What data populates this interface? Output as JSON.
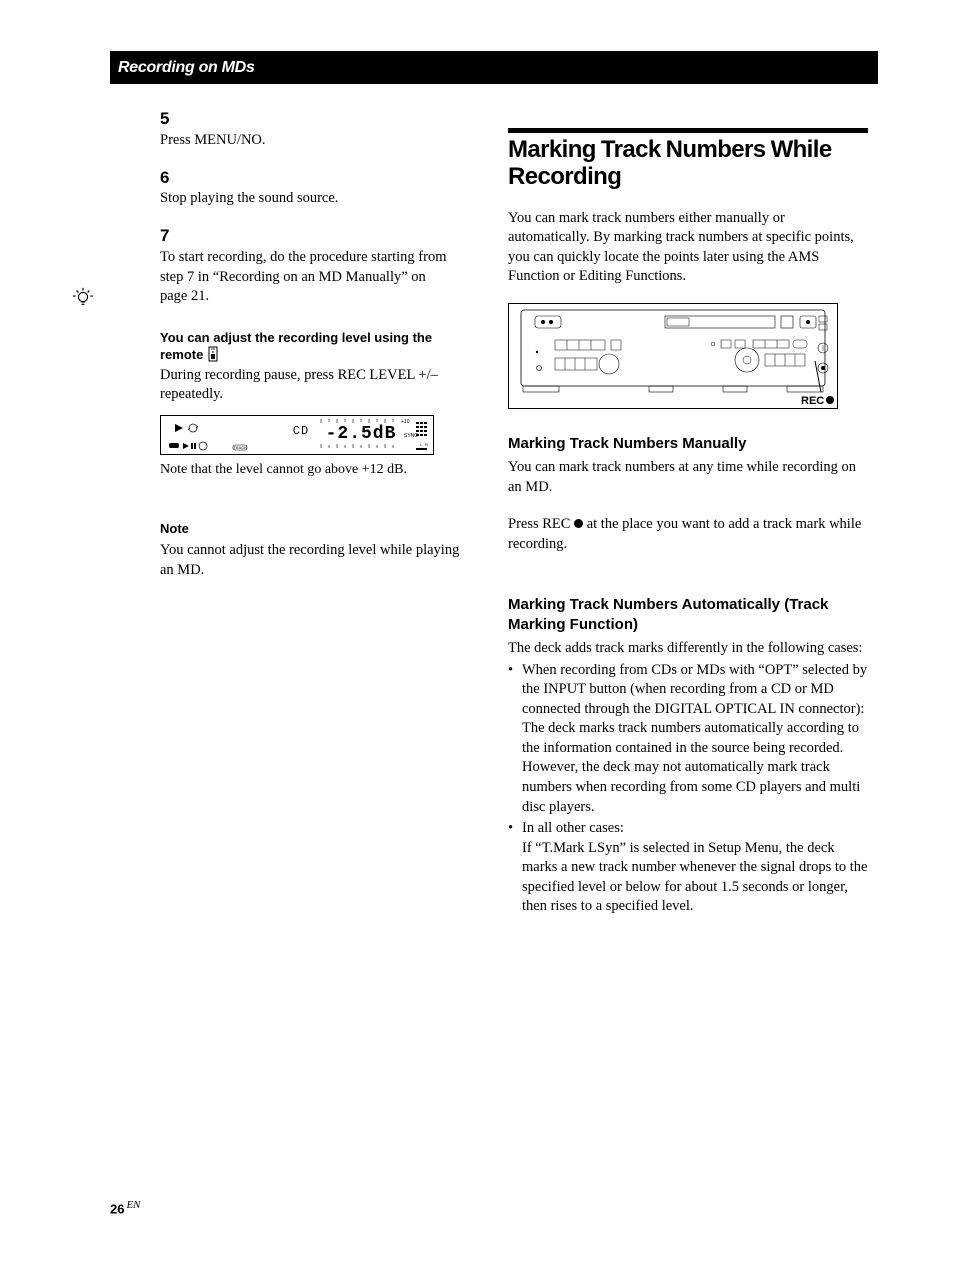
{
  "header": {
    "section": "Recording on MDs"
  },
  "left": {
    "steps": [
      {
        "n": "5",
        "text": "Press MENU/NO."
      },
      {
        "n": "6",
        "text": "Stop playing the sound source."
      },
      {
        "n": "7",
        "text": "To start recording, do the procedure starting from step 7 in “Recording on an MD Manually” on page 21."
      }
    ],
    "tip": {
      "head": "You can adjust the recording level using the remote",
      "body": "During recording pause, press REC LEVEL +/– repeatedly.",
      "display_value": "–2.5dB",
      "display_source": "CD",
      "note": "Note that the level cannot go above +12 dB."
    },
    "note": {
      "head": "Note",
      "body": "You cannot adjust the recording level while playing an MD."
    }
  },
  "right": {
    "title": "Marking Track Numbers While Recording",
    "intro": "You can mark track numbers either manually or automatically.  By marking track numbers at specific points, you can quickly locate the points later using the AMS Function or Editing Functions.",
    "diagram_label": "REC ●",
    "manual": {
      "title": "Marking Track Numbers Manually",
      "p1": "You can mark track numbers at any time while recording on an MD.",
      "p2_before": "Press REC ",
      "p2_after": " at the place you want to add a track mark while recording."
    },
    "auto": {
      "title": "Marking Track Numbers Automatically (Track Marking Function)",
      "intro": "The deck adds track marks differently in the following cases:",
      "cases": [
        {
          "lead": "When recording from CDs or MDs with “OPT” selected by the INPUT button (when recording from a CD or MD connected through the DIGITAL OPTICAL IN connector):",
          "body": "The deck marks track numbers automatically according to the information contained in the source being recorded. However, the deck may not automatically mark track numbers when recording from some CD players and multi disc players."
        },
        {
          "lead": "In all other cases:",
          "body": "If “T.Mark LSyn” is selected in Setup Menu, the deck marks a new track number whenever the signal drops to the specified level or below for about 1.5 seconds or longer, then rises to a specified level."
        }
      ]
    }
  },
  "page": {
    "number": "26",
    "suffix": "EN"
  }
}
